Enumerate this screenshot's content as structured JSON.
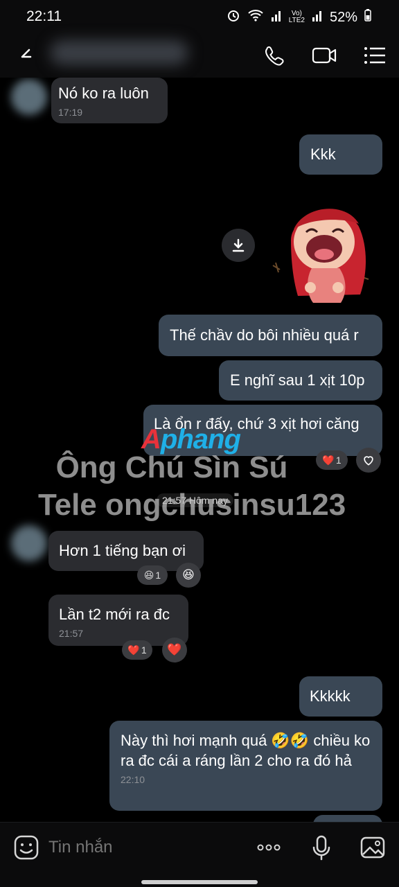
{
  "status_bar": {
    "time": "22:11",
    "network_top": "Vo)",
    "network_bottom": "LTE2",
    "battery": "52%"
  },
  "header": {
    "contact_name": ""
  },
  "messages": {
    "m1": {
      "text": "Nó ko ra luôn",
      "time": "17:19"
    },
    "m2": {
      "text": "Kkk"
    },
    "m3": {
      "text": "Thế chầv do bôi nhiều quá r"
    },
    "m4": {
      "text": "E nghĩ sau 1 xịt 10p"
    },
    "m5": {
      "text": "Là ổn r đấy, chứ 3 xịt hơi căng",
      "reaction_count": "1"
    },
    "m6": {
      "text": "Hơn 1 tiếng bạn ơi",
      "reaction_count": "1"
    },
    "m7": {
      "text": "Lần t2 mới ra đc",
      "time": "21:57",
      "reaction_count": "1"
    },
    "m8": {
      "text": "Kkkkk"
    },
    "m9": {
      "text": "Này thì hơi mạnh quá 🤣🤣 chiều ko ra đc cái a ráng lần 2 cho ra đó hả",
      "time": "22:10"
    }
  },
  "date_separator": "21:57 Hôm nay",
  "watermark": {
    "brand_a": "A",
    "brand_b": "phang",
    "line1": "Ông Chú Sìn Sú",
    "line2": "Tele ongchusinsu123"
  },
  "composer": {
    "placeholder": "Tin nhắn"
  },
  "colors": {
    "outgoing_bubble": "#3a4755",
    "incoming_bubble": "#2b2c30",
    "background": "#000000"
  }
}
